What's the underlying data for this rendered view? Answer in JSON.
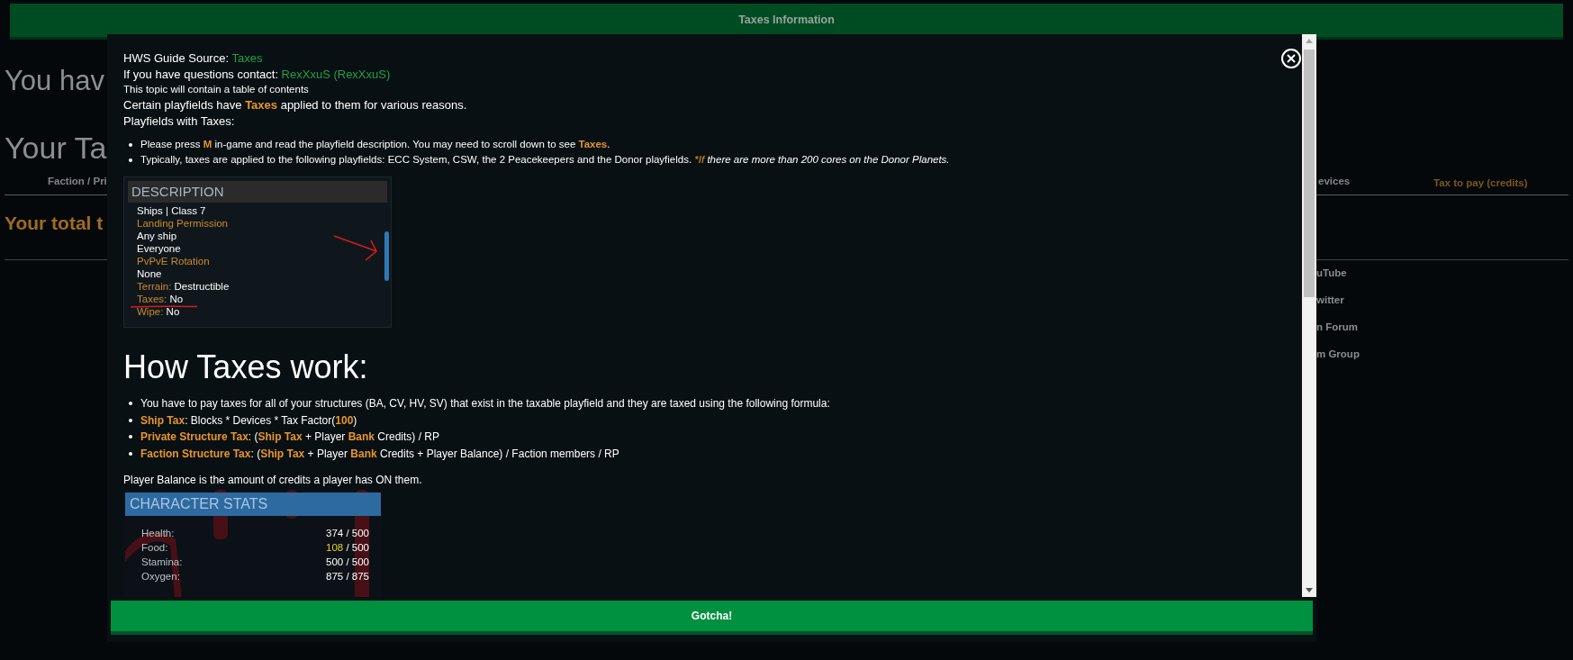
{
  "header": {
    "title": "Taxes Information"
  },
  "background": {
    "headings": [
      "You hav",
      "Your Ta"
    ],
    "columns": [
      "Faction / Pri",
      "evices",
      "Tax to pay (credits)"
    ],
    "total": "Your total t",
    "links": [
      "uTube",
      "witter",
      "n Forum",
      "m Group"
    ]
  },
  "modal": {
    "intro": [
      {
        "kind": "text",
        "segments": [
          {
            "kind": "plain",
            "text": "HWS Guide Source: "
          },
          {
            "kind": "link",
            "text": "Taxes"
          }
        ]
      },
      {
        "kind": "text",
        "segments": [
          {
            "kind": "plain",
            "text": "If you have questions contact: "
          },
          {
            "kind": "link",
            "text": "RexXxuS (RexXxuS)"
          }
        ]
      },
      {
        "kind": "note",
        "segments": [
          {
            "kind": "plain",
            "text": "This topic will contain a table of contents"
          }
        ]
      },
      {
        "kind": "text",
        "segments": [
          {
            "kind": "plain",
            "text": "Certain playfields have "
          },
          {
            "kind": "accent",
            "text": "Taxes"
          },
          {
            "kind": "plain",
            "text": " applied to them for various reasons."
          }
        ]
      },
      {
        "kind": "text",
        "segments": [
          {
            "kind": "plain",
            "text": "Playfields with Taxes:"
          }
        ]
      }
    ],
    "intro_bullets": [
      {
        "segments": [
          {
            "kind": "plain",
            "text": "Please press "
          },
          {
            "kind": "accent",
            "text": "M"
          },
          {
            "kind": "plain",
            "text": " in-game and read the playfield description. You may need to scroll down to see "
          },
          {
            "kind": "accent",
            "text": "Taxes"
          },
          {
            "kind": "plain",
            "text": "."
          }
        ]
      },
      {
        "segments": [
          {
            "kind": "plain",
            "text": "Typically, taxes are applied to the following playfields: ECC System, CSW, the 2 Peacekeepers and the Donor playfields. "
          },
          {
            "kind": "accent-italic",
            "text": "*If"
          },
          {
            "kind": "italic",
            "text": " there are more than 200 cores on the Donor Planets."
          }
        ]
      }
    ],
    "description_image": {
      "title": "DESCRIPTION",
      "lines": [
        {
          "value": "Ships | Class 7"
        },
        {
          "label": "Landing Permission"
        },
        {
          "value": "Any ship"
        },
        {
          "value": "Everyone"
        },
        {
          "label": "PvPvE Rotation"
        },
        {
          "value": "None"
        },
        {
          "label": "Terrain:",
          "value": "Destructible"
        },
        {
          "label": "Taxes:",
          "value": "No"
        },
        {
          "label": "Wipe:",
          "value": "No"
        }
      ]
    },
    "section_title": "How Taxes work:",
    "formula_bullets": [
      {
        "segments": [
          {
            "kind": "plain",
            "text": "You have to pay taxes for all of your structures (BA, CV, HV, SV) that exist in the taxable playfield and they are taxed using the following formula:"
          }
        ]
      },
      {
        "segments": [
          {
            "kind": "accent",
            "text": "Ship Tax"
          },
          {
            "kind": "plain",
            "text": ": Blocks * Devices * Tax Factor("
          },
          {
            "kind": "accent",
            "text": "100"
          },
          {
            "kind": "plain",
            "text": ")"
          }
        ]
      },
      {
        "segments": [
          {
            "kind": "accent",
            "text": "Private Structure Tax"
          },
          {
            "kind": "plain",
            "text": ": ("
          },
          {
            "kind": "accent",
            "text": "Ship Tax"
          },
          {
            "kind": "plain",
            "text": " + Player "
          },
          {
            "kind": "accent",
            "text": "Bank"
          },
          {
            "kind": "plain",
            "text": " Credits) / RP"
          }
        ]
      },
      {
        "segments": [
          {
            "kind": "accent",
            "text": "Faction Structure Tax"
          },
          {
            "kind": "plain",
            "text": ": ("
          },
          {
            "kind": "accent",
            "text": "Ship Tax"
          },
          {
            "kind": "plain",
            "text": " + Player "
          },
          {
            "kind": "accent",
            "text": "Bank"
          },
          {
            "kind": "plain",
            "text": " Credits + Player Balance) / Faction members / RP"
          }
        ]
      }
    ],
    "balance_note": "Player Balance is the amount of credits a player has ON them.",
    "stats_image": {
      "title": "CHARACTER STATS",
      "stats": [
        {
          "label": "Health:",
          "current": "374",
          "max": "/ 500",
          "warning": false
        },
        {
          "label": "Food:",
          "current": "108",
          "max": "/ 500",
          "warning": true
        },
        {
          "label": "Stamina:",
          "current": "500",
          "max": "/ 500",
          "warning": false
        },
        {
          "label": "Oxygen:",
          "current": "875",
          "max": "/ 875",
          "warning": false
        }
      ]
    },
    "confirm_button": "Gotcha!"
  }
}
